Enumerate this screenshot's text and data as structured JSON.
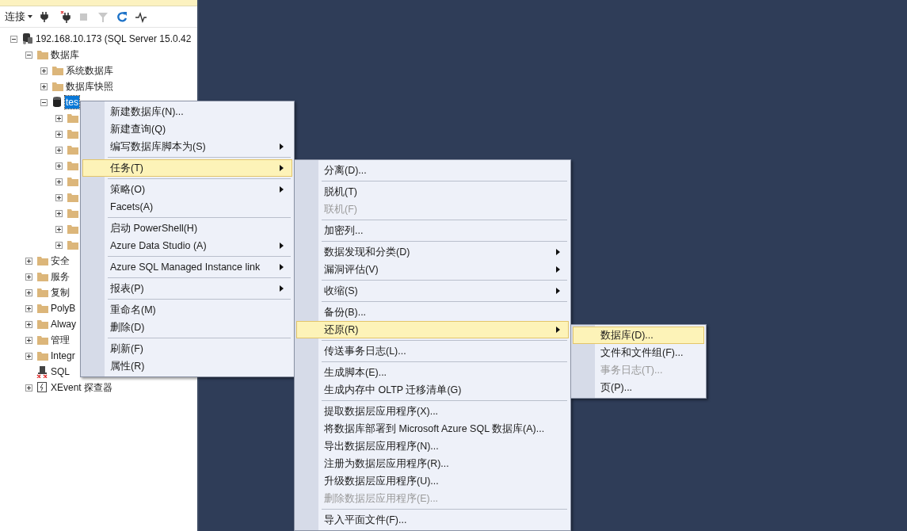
{
  "toolbar": {
    "connect_label": "连接",
    "buttons": [
      {
        "kind": "plug",
        "disabled": false
      },
      {
        "kind": "plug-x",
        "disabled": false
      },
      {
        "kind": "stop",
        "disabled": true
      },
      {
        "kind": "filter",
        "disabled": true
      },
      {
        "kind": "refresh",
        "disabled": false
      },
      {
        "kind": "activity",
        "disabled": false
      }
    ]
  },
  "tree": [
    {
      "kind": "server",
      "label": "192.168.10.173 (SQL Server 15.0.42",
      "expanded": true,
      "selected": false,
      "children": [
        {
          "kind": "folder",
          "label": "数据库",
          "expanded": true,
          "selected": false,
          "children": [
            {
              "kind": "folder",
              "label": "系统数据库",
              "expanded": false,
              "selected": false
            },
            {
              "kind": "folder",
              "label": "数据库快照",
              "expanded": false,
              "selected": false
            },
            {
              "kind": "database",
              "label": "tes",
              "expanded": true,
              "selected": true,
              "children": [
                {
                  "kind": "folder",
                  "expanded": false
                },
                {
                  "kind": "folder",
                  "expanded": false
                },
                {
                  "kind": "folder",
                  "expanded": false
                },
                {
                  "kind": "folder",
                  "expanded": false
                },
                {
                  "kind": "folder",
                  "expanded": false
                },
                {
                  "kind": "folder",
                  "expanded": false
                },
                {
                  "kind": "folder",
                  "expanded": false
                },
                {
                  "kind": "folder",
                  "expanded": false
                },
                {
                  "kind": "folder",
                  "expanded": false
                }
              ]
            }
          ]
        },
        {
          "kind": "folder",
          "label": "安全",
          "expanded": false,
          "selected": false
        },
        {
          "kind": "folder",
          "label": "服务",
          "expanded": false,
          "selected": false
        },
        {
          "kind": "folder",
          "label": "复制",
          "expanded": false,
          "selected": false
        },
        {
          "kind": "folder",
          "label": "PolyB",
          "expanded": false,
          "selected": false
        },
        {
          "kind": "folder",
          "label": "Alway",
          "expanded": false,
          "selected": false
        },
        {
          "kind": "folder",
          "label": "管理",
          "expanded": false,
          "selected": false
        },
        {
          "kind": "folder",
          "label": "Integr",
          "expanded": false,
          "selected": false
        },
        {
          "kind": "agent",
          "label": "SQL",
          "selected": false
        },
        {
          "kind": "xevent",
          "label": "XEvent 探查器",
          "expanded": false,
          "selected": false
        }
      ]
    }
  ],
  "menus": [
    {
      "groups": [
        [
          {
            "label": "新建数据库(N)...",
            "submenu": false,
            "disabled": false,
            "selected": false
          },
          {
            "label": "新建查询(Q)",
            "submenu": false,
            "disabled": false,
            "selected": false
          },
          {
            "label": "编写数据库脚本为(S)",
            "submenu": true,
            "disabled": false,
            "selected": false
          }
        ],
        [
          {
            "label": "任务(T)",
            "submenu": true,
            "disabled": false,
            "selected": true
          }
        ],
        [
          {
            "label": "策略(O)",
            "submenu": true,
            "disabled": false,
            "selected": false
          },
          {
            "label": "Facets(A)",
            "submenu": false,
            "disabled": false,
            "selected": false
          }
        ],
        [
          {
            "label": "启动 PowerShell(H)",
            "submenu": false,
            "disabled": false,
            "selected": false
          },
          {
            "label": "Azure Data Studio (A)",
            "submenu": true,
            "disabled": false,
            "selected": false
          }
        ],
        [
          {
            "label": "Azure SQL Managed Instance link",
            "submenu": true,
            "disabled": false,
            "selected": false
          }
        ],
        [
          {
            "label": "报表(P)",
            "submenu": true,
            "disabled": false,
            "selected": false
          }
        ],
        [
          {
            "label": "重命名(M)",
            "submenu": false,
            "disabled": false,
            "selected": false
          },
          {
            "label": "删除(D)",
            "submenu": false,
            "disabled": false,
            "selected": false
          }
        ],
        [
          {
            "label": "刷新(F)",
            "submenu": false,
            "disabled": false,
            "selected": false
          },
          {
            "label": "属性(R)",
            "submenu": false,
            "disabled": false,
            "selected": false
          }
        ]
      ]
    },
    {
      "groups": [
        [
          {
            "label": "分离(D)...",
            "submenu": false,
            "disabled": false,
            "selected": false
          }
        ],
        [
          {
            "label": "脱机(T)",
            "submenu": false,
            "disabled": false,
            "selected": false
          },
          {
            "label": "联机(F)",
            "submenu": false,
            "disabled": true,
            "selected": false
          }
        ],
        [
          {
            "label": "加密列...",
            "submenu": false,
            "disabled": false,
            "selected": false
          }
        ],
        [
          {
            "label": "数据发现和分类(D)",
            "submenu": true,
            "disabled": false,
            "selected": false
          },
          {
            "label": "漏洞评估(V)",
            "submenu": true,
            "disabled": false,
            "selected": false
          }
        ],
        [
          {
            "label": "收缩(S)",
            "submenu": true,
            "disabled": false,
            "selected": false
          }
        ],
        [
          {
            "label": "备份(B)...",
            "submenu": false,
            "disabled": false,
            "selected": false
          },
          {
            "label": "还原(R)",
            "submenu": true,
            "disabled": false,
            "selected": true
          }
        ],
        [
          {
            "label": "传送事务日志(L)...",
            "submenu": false,
            "disabled": false,
            "selected": false
          }
        ],
        [
          {
            "label": "生成脚本(E)...",
            "submenu": false,
            "disabled": false,
            "selected": false
          },
          {
            "label": "生成内存中 OLTP 迁移清单(G)",
            "submenu": false,
            "disabled": false,
            "selected": false
          }
        ],
        [
          {
            "label": "提取数据层应用程序(X)...",
            "submenu": false,
            "disabled": false,
            "selected": false
          },
          {
            "label": "将数据库部署到 Microsoft Azure SQL 数据库(A)...",
            "submenu": false,
            "disabled": false,
            "selected": false
          },
          {
            "label": "导出数据层应用程序(N)...",
            "submenu": false,
            "disabled": false,
            "selected": false
          },
          {
            "label": "注册为数据层应用程序(R)...",
            "submenu": false,
            "disabled": false,
            "selected": false
          },
          {
            "label": "升级数据层应用程序(U)...",
            "submenu": false,
            "disabled": false,
            "selected": false
          },
          {
            "label": "删除数据层应用程序(E)...",
            "submenu": false,
            "disabled": true,
            "selected": false
          }
        ],
        [
          {
            "label": "导入平面文件(F)...",
            "submenu": false,
            "disabled": false,
            "selected": false
          }
        ]
      ]
    },
    {
      "groups": [
        [
          {
            "label": "数据库(D)...",
            "submenu": false,
            "disabled": false,
            "selected": true
          },
          {
            "label": "文件和文件组(F)...",
            "submenu": false,
            "disabled": false,
            "selected": false
          },
          {
            "label": "事务日志(T)...",
            "submenu": false,
            "disabled": true,
            "selected": false
          },
          {
            "label": "页(P)...",
            "submenu": false,
            "disabled": false,
            "selected": false
          }
        ]
      ]
    }
  ]
}
